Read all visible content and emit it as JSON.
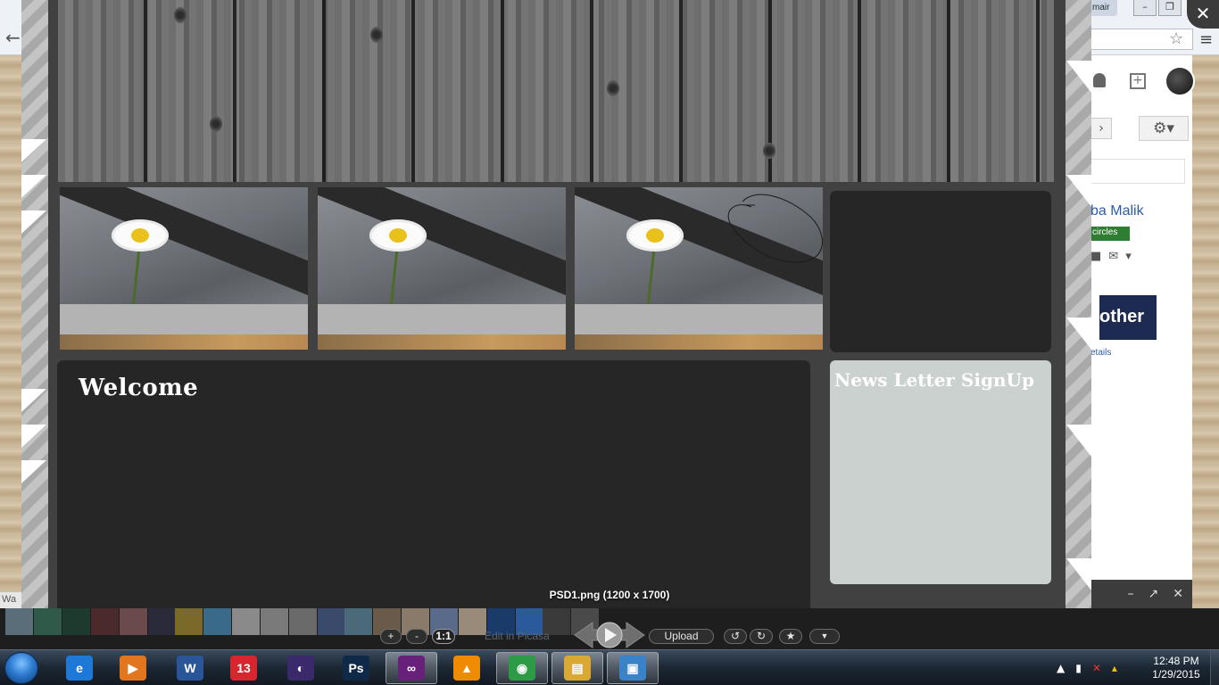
{
  "background_browser": {
    "tab_fragment": "mair",
    "profile_name_fragment": "ba Malik",
    "circles_badge": "circles",
    "promo_fragment": "other",
    "details_fragment": "etails",
    "left_fragment": "Wa"
  },
  "viewer": {
    "close_label": "✕",
    "image_caption": "PSD1.png (1200 x 1700)",
    "edit_label": "Edit in Picasa",
    "controls": {
      "zoom_in": "+",
      "zoom_out": "-",
      "actual_size": "1:1",
      "upload": "Upload",
      "rotate_left": "↺",
      "rotate_right": "↻",
      "star": "★",
      "more": "▼"
    }
  },
  "mockup": {
    "welcome_title": "Welcome",
    "newsletter_title": "News Letter SignUp"
  },
  "taskbar": {
    "apps": [
      {
        "name": "internet-explorer",
        "glyph": "e",
        "color": "#1e78d6"
      },
      {
        "name": "windows-media-player",
        "glyph": "▶",
        "color": "#e2761f"
      },
      {
        "name": "microsoft-word",
        "glyph": "W",
        "color": "#2a5699"
      },
      {
        "name": "app-13",
        "glyph": "13",
        "color": "#d9262e"
      },
      {
        "name": "eclipse",
        "glyph": "◐",
        "color": "#3b2a6b"
      },
      {
        "name": "photoshop",
        "glyph": "Ps",
        "color": "#0f2a49"
      },
      {
        "name": "visual-studio",
        "glyph": "∞",
        "color": "#68217a"
      },
      {
        "name": "vlc",
        "glyph": "▲",
        "color": "#f08a00"
      },
      {
        "name": "chrome",
        "glyph": "◉",
        "color": "#2d9b45"
      },
      {
        "name": "file-explorer",
        "glyph": "▤",
        "color": "#d9a933"
      },
      {
        "name": "picasa-photo-viewer",
        "glyph": "▣",
        "color": "#3a83c9"
      }
    ],
    "clock_time": "12:48 PM",
    "clock_date": "1/29/2015"
  }
}
